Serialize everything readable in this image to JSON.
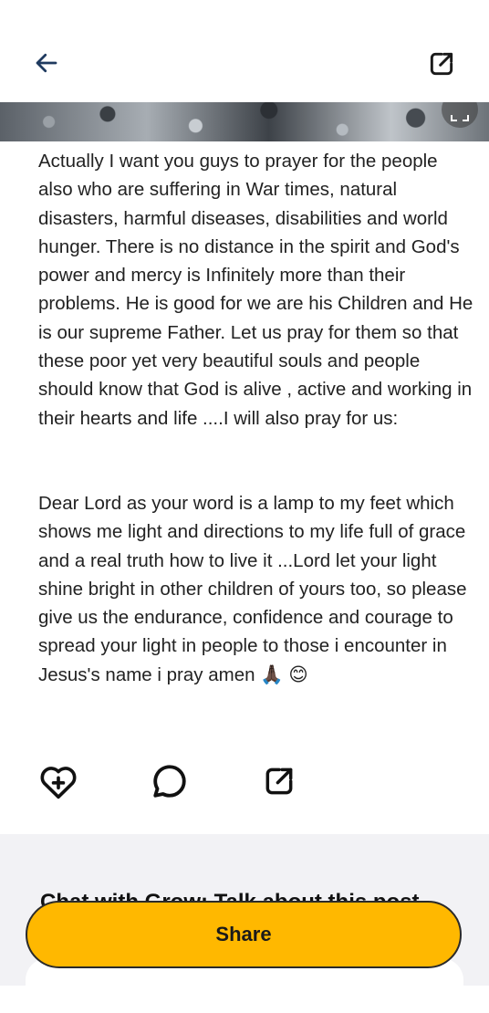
{
  "header": {
    "back_icon": "arrow-left-icon",
    "external_icon": "external-link-icon"
  },
  "hero": {
    "expand_icon": "expand-icon"
  },
  "post": {
    "paragraph1": "Actually I want you guys to prayer for the people also who are suffering in War times, natural disasters, harmful diseases, disabilities and world hunger. There is no distance in the spirit and God's power and mercy is Infinitely more than their problems. He is good for we are his Children and He is our supreme Father. Let us pray for them so that these poor yet very beautiful souls and people should know that God is alive , active and working in their hearts and life ....I will also pray for us:",
    "paragraph2": "Dear Lord as your word is a lamp to my feet which shows me light and directions to my life full of grace and a real truth how to live it ...Lord let your light shine bright in other children of yours too, so please give us the endurance, confidence and courage to spread your light in people to those i encounter in Jesus's name i pray amen 🙏🏿 😊"
  },
  "actions": {
    "like_icon": "heart-plus-icon",
    "comment_icon": "comment-bubble-icon",
    "share_icon": "external-link-icon"
  },
  "chat_section": {
    "title": "Chat with Grow: Talk about this post"
  },
  "share_button": {
    "label": "Share"
  },
  "colors": {
    "accent": "#ffb800",
    "icon": "#1a1a1a",
    "header_icon": "#1f3a5f"
  }
}
